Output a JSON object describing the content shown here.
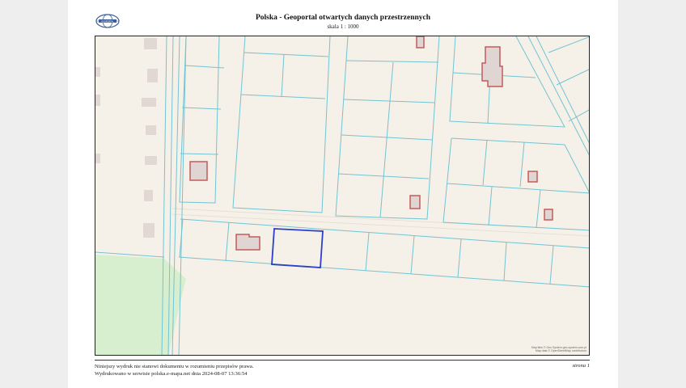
{
  "header": {
    "title": "Polska - Geoportal otwartych danych przestrzennych",
    "scale": "skala 1 : 1000",
    "logo_icon": "geoportal-globe-logo"
  },
  "map": {
    "attribution_line1": "Map tiles © Geo System geo-system.com.pl",
    "attribution_line2": "Map data © OpenStreetMap contributors",
    "colors": {
      "background": "#f6f1e8",
      "parcel_line": "#72c3d3",
      "building_fill": "#dfd6d3",
      "building_outline": "#c45a5a",
      "selected_parcel": "#2b3fc8",
      "green_area": "#d8efcf"
    }
  },
  "footer": {
    "disclaimer_line1": "Niniejszy wydruk nie stanowi dokumentu w rozumieniu przepisów prawa.",
    "disclaimer_line2": "Wydrukowano w serwisie polska.e-mapa.net dnia 2024-08-07 13:36:54",
    "page_label": "strona 1"
  }
}
